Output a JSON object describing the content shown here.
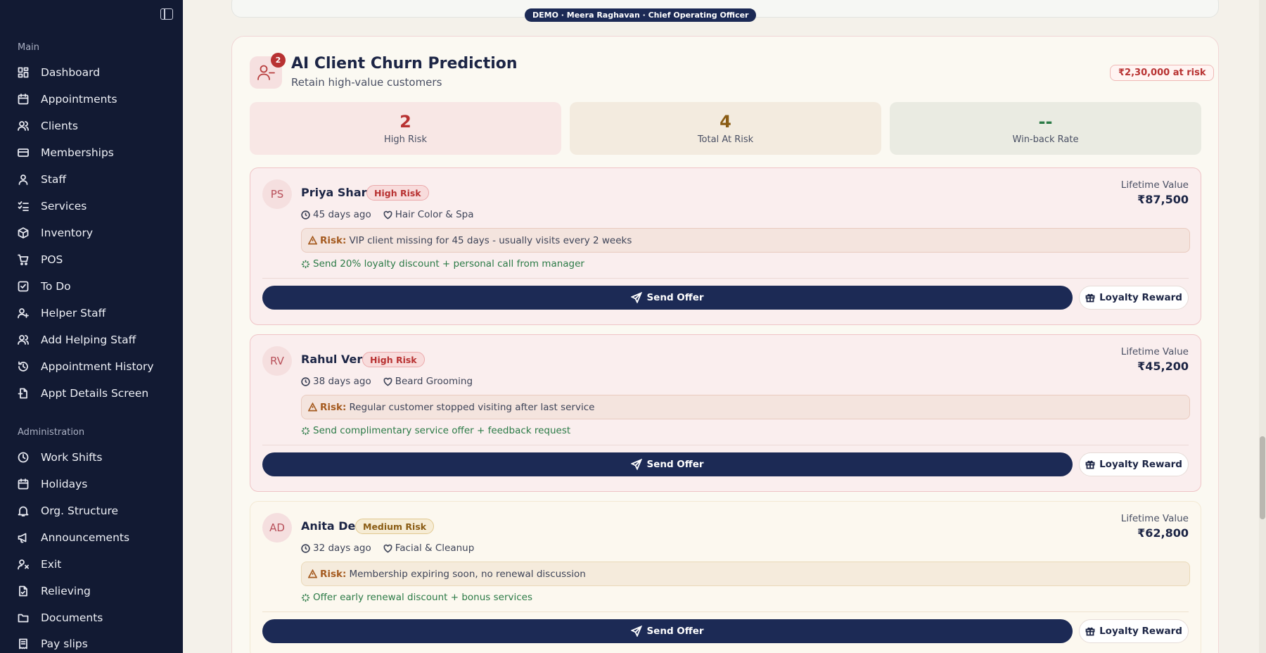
{
  "sidebar": {
    "main_label": "Main",
    "main_items": [
      {
        "label": "Dashboard",
        "icon": "dashboard-icon"
      },
      {
        "label": "Appointments",
        "icon": "calendar-icon"
      },
      {
        "label": "Clients",
        "icon": "users-icon"
      },
      {
        "label": "Memberships",
        "icon": "card-icon"
      },
      {
        "label": "Staff",
        "icon": "user-icon"
      },
      {
        "label": "Services",
        "icon": "checklist-icon"
      },
      {
        "label": "Inventory",
        "icon": "package-icon"
      },
      {
        "label": "POS",
        "icon": "cart-icon"
      },
      {
        "label": "To Do",
        "icon": "checkbox-icon"
      },
      {
        "label": "Helper Staff",
        "icon": "user-plus-icon"
      },
      {
        "label": "Add Helping Staff",
        "icon": "users-icon"
      },
      {
        "label": "Appointment History",
        "icon": "history-icon"
      },
      {
        "label": "Appt Details Screen",
        "icon": "file-icon"
      }
    ],
    "admin_label": "Administration",
    "admin_items": [
      {
        "label": "Work Shifts",
        "icon": "clock-icon"
      },
      {
        "label": "Holidays",
        "icon": "calendar-icon"
      },
      {
        "label": "Org. Structure",
        "icon": "bell-icon"
      },
      {
        "label": "Announcements",
        "icon": "megaphone-icon"
      },
      {
        "label": "Exit",
        "icon": "user-x-icon"
      },
      {
        "label": "Relieving",
        "icon": "document-check-icon"
      },
      {
        "label": "Documents",
        "icon": "folder-icon"
      },
      {
        "label": "Pay slips",
        "icon": "receipt-icon"
      }
    ]
  },
  "demo_banner": "DEMO · Meera Raghavan · Chief Operating Officer",
  "churn": {
    "badge_count": "2",
    "title": "AI Client Churn Prediction",
    "subtitle": "Retain high-value customers",
    "at_risk_total": "₹2,30,000 at risk",
    "stats": [
      {
        "value": "2",
        "label": "High Risk",
        "color": "#b83232",
        "bg": "#f8e7e5"
      },
      {
        "value": "4",
        "label": "Total At Risk",
        "color": "#8a5c14",
        "bg": "#f3ebdf"
      },
      {
        "value": "--",
        "label": "Win-back Rate",
        "color": "#2b7a46",
        "bg": "#eaebe2"
      }
    ],
    "clients": [
      {
        "initials": "PS",
        "name": "Priya Sharma",
        "risk_level": "High Risk",
        "last_visit": "45 days ago",
        "service": "Hair Color & Spa",
        "risk_key": "Risk:",
        "risk_text": "VIP client missing for 45 days - usually visits every 2 weeks",
        "action": "Send 20% loyalty discount + personal call from manager",
        "ltv_label": "Lifetime Value",
        "ltv": "₹87,500",
        "send_label": "Send Offer",
        "loyalty_label": "Loyalty Reward"
      },
      {
        "initials": "RV",
        "name": "Rahul Verma",
        "risk_level": "High Risk",
        "last_visit": "38 days ago",
        "service": "Beard Grooming",
        "risk_key": "Risk:",
        "risk_text": "Regular customer stopped visiting after last service",
        "action": "Send complimentary service offer + feedback request",
        "ltv_label": "Lifetime Value",
        "ltv": "₹45,200",
        "send_label": "Send Offer",
        "loyalty_label": "Loyalty Reward"
      },
      {
        "initials": "AD",
        "name": "Anita Desai",
        "risk_level": "Medium Risk",
        "last_visit": "32 days ago",
        "service": "Facial & Cleanup",
        "risk_key": "Risk:",
        "risk_text": "Membership expiring soon, no renewal discussion",
        "action": "Offer early renewal discount + bonus services",
        "ltv_label": "Lifetime Value",
        "ltv": "₹62,800",
        "send_label": "Send Offer",
        "loyalty_label": "Loyalty Reward"
      }
    ]
  }
}
